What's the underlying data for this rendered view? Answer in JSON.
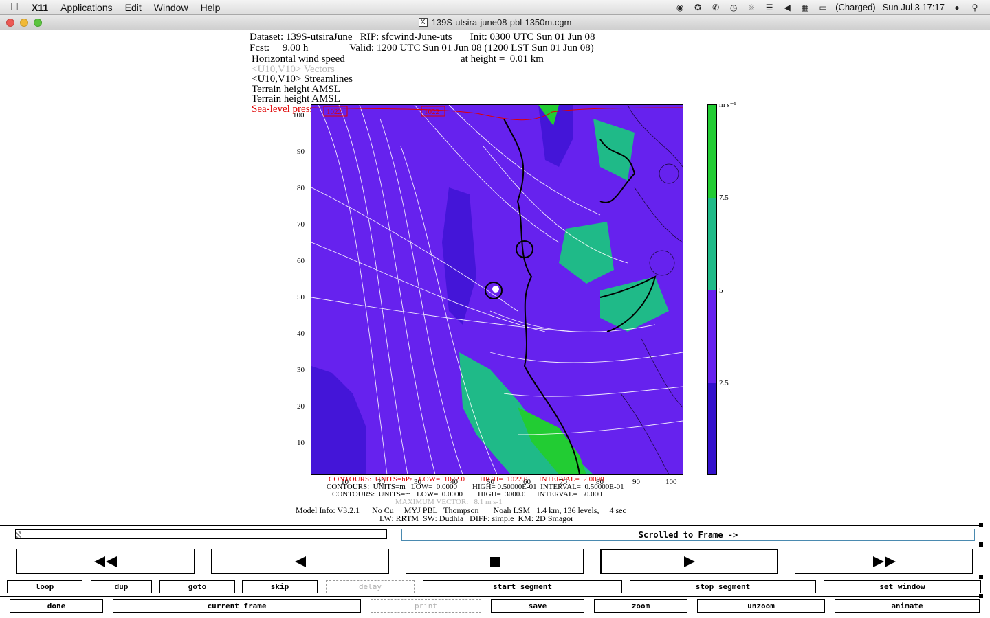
{
  "menubar": {
    "app_name": "X11",
    "items": [
      "Applications",
      "Edit",
      "Window",
      "Help"
    ],
    "battery": "(Charged)",
    "clock": "Sun Jul 3  17:17"
  },
  "window": {
    "title": "139S-utsira-june08-pbl-1350m.cgm"
  },
  "plot": {
    "dataset_line": "Dataset: 139S-utsiraJune   RIP: sfcwind-June-uts       Init: 0300 UTC Sun 01 Jun 08",
    "fcst_line": "Fcst:     9.00 h                Valid: 1200 UTC Sun 01 Jun 08 (1200 LST Sun 01 Jun 08)",
    "field1": "Horizontal wind speed",
    "height_text": "at height =  0.01 km",
    "field2": "<U10,V10> Vectors",
    "field3": "<U10,V10> Streamlines",
    "field4": "Terrain height AMSL",
    "field5": "Terrain height AMSL",
    "field6": "Sea-level pressure",
    "pressure_label1": "1022",
    "pressure_label2": "1022",
    "y_ticks": [
      "100",
      "90",
      "80",
      "70",
      "60",
      "50",
      "40",
      "30",
      "20",
      "10"
    ],
    "x_ticks": [
      "10",
      "20",
      "30",
      "40",
      "50",
      "60",
      "70",
      "80",
      "90",
      "100"
    ],
    "units_label": "m s⁻¹",
    "colorbar_labels": [
      "7.5",
      "5",
      "2.5"
    ],
    "colorbar_colors": [
      "#22cc33",
      "#1fba88",
      "#6622ee",
      "#3311cc"
    ],
    "footer_line1": "CONTOURS:  UNITS=hPa   LOW=  1022.0        HIGH=  1022.0      INTERVAL=  2.0000",
    "footer_line2": "CONTOURS:  UNITS=m   LOW=  0.0000        HIGH= 0.50000E-01  INTERVAL=  0.50000E-01",
    "footer_line3": "CONTOURS:  UNITS=m   LOW=  0.0000        HIGH=  3000.0      INTERVAL=  50.000",
    "footer_line4": "MAXIMUM VECTOR:   8.1 m s-1",
    "model_info1": "Model Info: V3.2.1      No Cu     MYJ PBL   Thompson       Noah LSM   1.4 km, 136 levels,     4 sec",
    "model_info2": "LW: RRTM  SW: Dudhia   DIFF: simple  KM: 2D Smagor"
  },
  "controls": {
    "frame_status": "Scrolled to Frame ->",
    "row1": [
      "loop",
      "dup",
      "goto",
      "skip",
      "delay",
      "start segment",
      "stop segment",
      "set window"
    ],
    "row2": [
      "done",
      "current frame",
      "print",
      "save",
      "zoom",
      "unzoom",
      "animate"
    ]
  }
}
